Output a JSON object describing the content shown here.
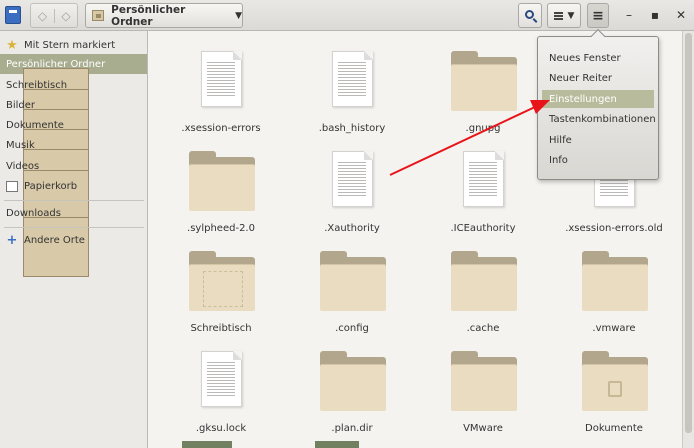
{
  "toolbar": {
    "app_icon": "file-manager-icon",
    "location": "Persönlicher Ordner",
    "back_icon": "back-arrow-icon",
    "forward_icon": "forward-arrow-icon",
    "search_icon": "magnifier-icon",
    "view_icon": "list-view-icon",
    "menu_icon": "hamburger-menu-icon",
    "min_symbol": "–",
    "max_symbol": "▪",
    "close_symbol": "✕"
  },
  "sidebar": {
    "items": [
      {
        "label": "Mit Stern markiert",
        "icon": "star-icon"
      },
      {
        "label": "Persönlicher Ordner",
        "icon": "home-folder-icon"
      },
      {
        "label": "Schreibtisch",
        "icon": "desktop-folder-icon"
      },
      {
        "label": "Bilder",
        "icon": "pictures-folder-icon"
      },
      {
        "label": "Dokumente",
        "icon": "documents-folder-icon"
      },
      {
        "label": "Musik",
        "icon": "music-folder-icon"
      },
      {
        "label": "Videos",
        "icon": "videos-folder-icon"
      },
      {
        "label": "Papierkorb",
        "icon": "trash-icon"
      },
      {
        "label": "Downloads",
        "icon": "downloads-folder-icon"
      },
      {
        "label": "Andere Orte",
        "icon": "plus-icon"
      }
    ],
    "selected": "Persönlicher Ordner"
  },
  "files": [
    {
      "name": ".xsession-errors",
      "kind": "text"
    },
    {
      "name": ".bash_history",
      "kind": "text"
    },
    {
      "name": ".gnupg",
      "kind": "folder"
    },
    {
      "name": ".sylpheed-2.0",
      "kind": "folder"
    },
    {
      "name": ".Xauthority",
      "kind": "text"
    },
    {
      "name": ".ICEauthority",
      "kind": "text"
    },
    {
      "name": ".xsession-errors.old",
      "kind": "text"
    },
    {
      "name": "Schreibtisch",
      "kind": "folder"
    },
    {
      "name": ".config",
      "kind": "folder"
    },
    {
      "name": ".cache",
      "kind": "folder"
    },
    {
      "name": ".vmware",
      "kind": "folder"
    },
    {
      "name": ".gksu.lock",
      "kind": "text"
    },
    {
      "name": ".plan.dir",
      "kind": "folder"
    },
    {
      "name": "VMware",
      "kind": "folder"
    },
    {
      "name": "Dokumente",
      "kind": "folder"
    }
  ],
  "menu": {
    "items": [
      {
        "label": "Neues Fenster"
      },
      {
        "label": "Neuer Reiter"
      },
      {
        "label": "Einstellungen"
      },
      {
        "label": "Tastenkombinationen"
      },
      {
        "label": "Hilfe"
      },
      {
        "label": "Info"
      }
    ],
    "highlighted": "Einstellungen"
  },
  "colors": {
    "annotation_arrow": "#e8141a",
    "selection": "#a8ad8f",
    "folder": "#eadcc0"
  }
}
